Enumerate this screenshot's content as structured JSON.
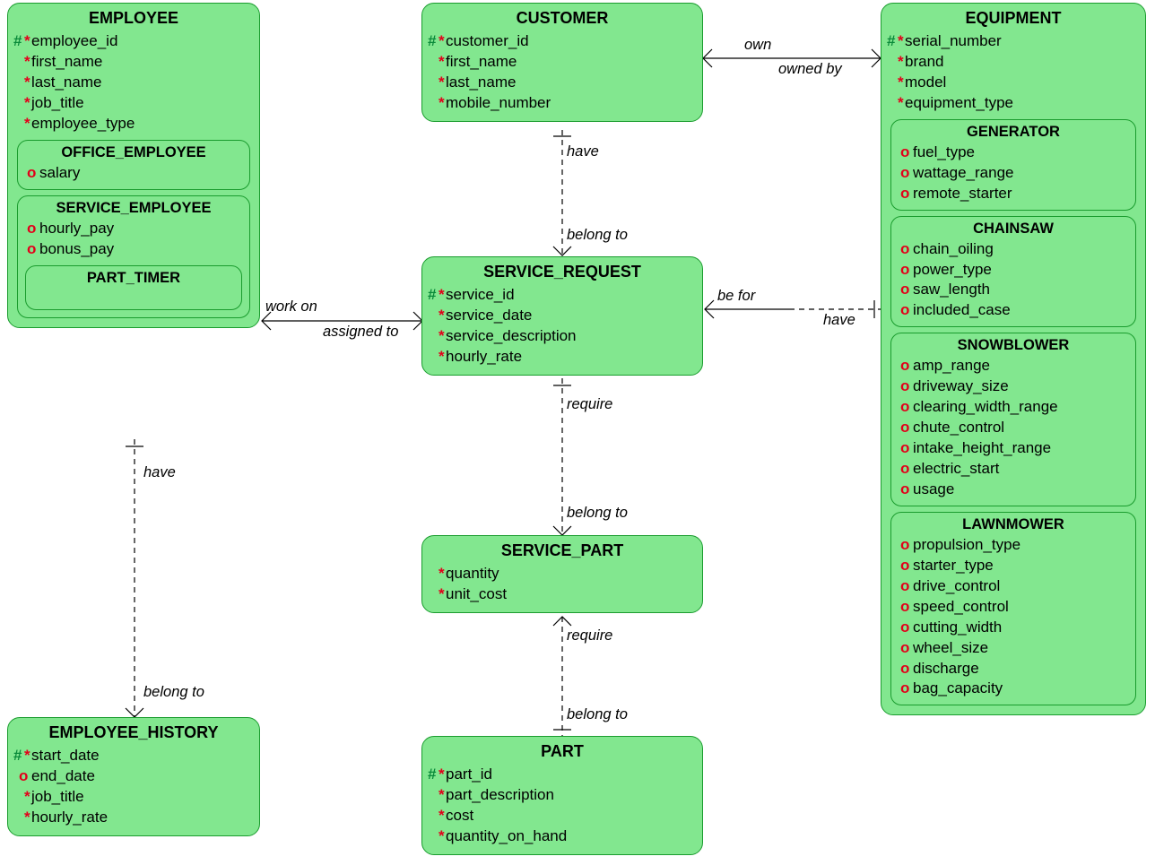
{
  "entities": {
    "employee": {
      "title": "EMPLOYEE",
      "attrs": [
        {
          "pk": true,
          "m": true,
          "name": "employee_id"
        },
        {
          "m": true,
          "name": "first_name"
        },
        {
          "m": true,
          "name": "last_name"
        },
        {
          "m": true,
          "name": "job_title"
        },
        {
          "m": true,
          "name": "employee_type"
        }
      ],
      "subs": {
        "office_employee": {
          "title": "OFFICE_EMPLOYEE",
          "attrs": [
            {
              "o": true,
              "name": "salary"
            }
          ]
        },
        "service_employee": {
          "title": "SERVICE_EMPLOYEE",
          "attrs": [
            {
              "o": true,
              "name": "hourly_pay"
            },
            {
              "o": true,
              "name": "bonus_pay"
            }
          ],
          "subs": {
            "part_timer": {
              "title": "PART_TIMER",
              "attrs": []
            }
          }
        }
      }
    },
    "customer": {
      "title": "CUSTOMER",
      "attrs": [
        {
          "pk": true,
          "m": true,
          "name": "customer_id"
        },
        {
          "m": true,
          "name": "first_name"
        },
        {
          "m": true,
          "name": "last_name"
        },
        {
          "m": true,
          "name": "mobile_number"
        }
      ]
    },
    "equipment": {
      "title": "EQUIPMENT",
      "attrs": [
        {
          "pk": true,
          "m": true,
          "name": "serial_number"
        },
        {
          "m": true,
          "name": "brand"
        },
        {
          "m": true,
          "name": "model"
        },
        {
          "m": true,
          "name": "equipment_type"
        }
      ],
      "subs": {
        "generator": {
          "title": "GENERATOR",
          "attrs": [
            {
              "o": true,
              "name": "fuel_type"
            },
            {
              "o": true,
              "name": "wattage_range"
            },
            {
              "o": true,
              "name": "remote_starter"
            }
          ]
        },
        "chainsaw": {
          "title": "CHAINSAW",
          "attrs": [
            {
              "o": true,
              "name": "chain_oiling"
            },
            {
              "o": true,
              "name": "power_type"
            },
            {
              "o": true,
              "name": "saw_length"
            },
            {
              "o": true,
              "name": "included_case"
            }
          ]
        },
        "snowblower": {
          "title": "SNOWBLOWER",
          "attrs": [
            {
              "o": true,
              "name": "amp_range"
            },
            {
              "o": true,
              "name": "driveway_size"
            },
            {
              "o": true,
              "name": "clearing_width_range"
            },
            {
              "o": true,
              "name": "chute_control"
            },
            {
              "o": true,
              "name": "intake_height_range"
            },
            {
              "o": true,
              "name": "electric_start"
            },
            {
              "o": true,
              "name": "usage"
            }
          ]
        },
        "lawnmower": {
          "title": "LAWNMOWER",
          "attrs": [
            {
              "o": true,
              "name": "propulsion_type"
            },
            {
              "o": true,
              "name": "starter_type"
            },
            {
              "o": true,
              "name": "drive_control"
            },
            {
              "o": true,
              "name": "speed_control"
            },
            {
              "o": true,
              "name": "cutting_width"
            },
            {
              "o": true,
              "name": "wheel_size"
            },
            {
              "o": true,
              "name": "discharge"
            },
            {
              "o": true,
              "name": "bag_capacity"
            }
          ]
        }
      }
    },
    "service_request": {
      "title": "SERVICE_REQUEST",
      "attrs": [
        {
          "pk": true,
          "m": true,
          "name": "service_id"
        },
        {
          "m": true,
          "name": "service_date"
        },
        {
          "m": true,
          "name": "service_description"
        },
        {
          "m": true,
          "name": "hourly_rate"
        }
      ]
    },
    "service_part": {
      "title": "SERVICE_PART",
      "attrs": [
        {
          "m": true,
          "name": "quantity"
        },
        {
          "m": true,
          "name": "unit_cost"
        }
      ]
    },
    "part": {
      "title": "PART",
      "attrs": [
        {
          "pk": true,
          "m": true,
          "name": "part_id"
        },
        {
          "m": true,
          "name": "part_description"
        },
        {
          "m": true,
          "name": "cost"
        },
        {
          "m": true,
          "name": "quantity_on_hand"
        }
      ]
    },
    "employee_history": {
      "title": "EMPLOYEE_HISTORY",
      "attrs": [
        {
          "pk": true,
          "m": true,
          "name": "start_date"
        },
        {
          "o": true,
          "name": "end_date"
        },
        {
          "m": true,
          "name": "job_title"
        },
        {
          "m": true,
          "name": "hourly_rate"
        }
      ]
    }
  },
  "labels": {
    "own": "own",
    "owned_by": "owned by",
    "have1": "have",
    "belong_to1": "belong to",
    "work_on": "work on",
    "assigned_to": "assigned to",
    "be_for": "be for",
    "have2": "have",
    "require1": "require",
    "belong_to2": "belong to",
    "require2": "require",
    "belong_to3": "belong to",
    "have3": "have",
    "belong_to4": "belong to"
  }
}
